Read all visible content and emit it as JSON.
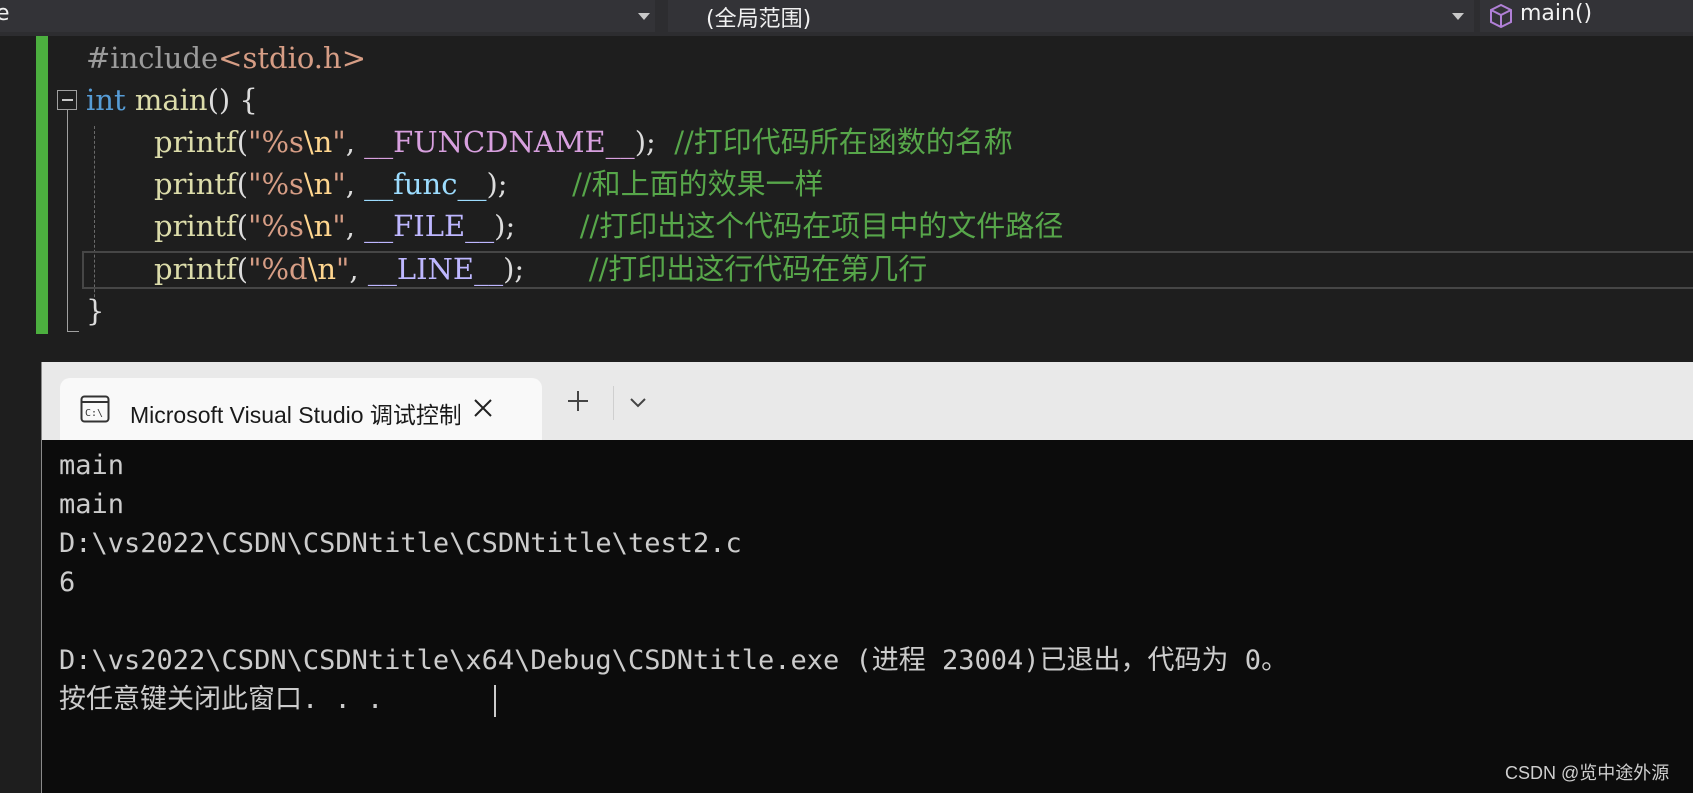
{
  "navbar": {
    "left_fragment": "e",
    "scope": "(全局范围)",
    "function_name": "main()"
  },
  "editor": {
    "lines": [
      [
        {
          "t": "#include",
          "c": "tok-pre"
        },
        {
          "t": "<stdio.h>",
          "c": "tok-inc"
        }
      ],
      [
        {
          "t": "int",
          "c": "tok-kw"
        },
        {
          "t": " ",
          "c": ""
        },
        {
          "t": "main",
          "c": "tok-fn"
        },
        {
          "t": "() {",
          "c": ""
        }
      ],
      [
        {
          "t": "printf",
          "c": "tok-fn"
        },
        {
          "t": "(",
          "c": ""
        },
        {
          "t": "\"%s",
          "c": "tok-str"
        },
        {
          "t": "\\n",
          "c": "tok-esc"
        },
        {
          "t": "\"",
          "c": "tok-str"
        },
        {
          "t": ", ",
          "c": ""
        },
        {
          "t": "__FUNCDNAME__",
          "c": "tok-macb"
        },
        {
          "t": ");  ",
          "c": ""
        },
        {
          "t": "//打印代码所在函数的名称",
          "c": "tok-cm"
        }
      ],
      [
        {
          "t": "printf",
          "c": "tok-fn"
        },
        {
          "t": "(",
          "c": ""
        },
        {
          "t": "\"%s",
          "c": "tok-str"
        },
        {
          "t": "\\n",
          "c": "tok-esc"
        },
        {
          "t": "\"",
          "c": "tok-str"
        },
        {
          "t": ", ",
          "c": ""
        },
        {
          "t": "__func__",
          "c": "tok-id"
        },
        {
          "t": ");       ",
          "c": ""
        },
        {
          "t": "//和上面的效果一样",
          "c": "tok-cm"
        }
      ],
      [
        {
          "t": "printf",
          "c": "tok-fn"
        },
        {
          "t": "(",
          "c": ""
        },
        {
          "t": "\"%s",
          "c": "tok-str"
        },
        {
          "t": "\\n",
          "c": "tok-esc"
        },
        {
          "t": "\"",
          "c": "tok-str"
        },
        {
          "t": ", ",
          "c": ""
        },
        {
          "t": "__FILE__",
          "c": "tok-mac"
        },
        {
          "t": ");       ",
          "c": ""
        },
        {
          "t": "//打印出这个代码在项目中的文件路径",
          "c": "tok-cm"
        }
      ],
      [
        {
          "t": "printf",
          "c": "tok-fn"
        },
        {
          "t": "(",
          "c": ""
        },
        {
          "t": "\"%d",
          "c": "tok-str"
        },
        {
          "t": "\\n",
          "c": "tok-esc"
        },
        {
          "t": "\"",
          "c": "tok-str"
        },
        {
          "t": ", ",
          "c": ""
        },
        {
          "t": "__LINE__",
          "c": "tok-mac"
        },
        {
          "t": ");       ",
          "c": ""
        },
        {
          "t": "//打印出这行代码在第几行",
          "c": "tok-cm"
        }
      ],
      [
        {
          "t": "}",
          "c": ""
        }
      ]
    ]
  },
  "console": {
    "tab_title": "Microsoft Visual Studio 调试控制台",
    "icon_label": "C:\\",
    "output": [
      "main",
      "main",
      "D:\\vs2022\\CSDN\\CSDNtitle\\CSDNtitle\\test2.c",
      "6",
      "",
      "D:\\vs2022\\CSDN\\CSDNtitle\\x64\\Debug\\CSDNtitle.exe (进程 23004)已退出，代码为 0。",
      "按任意键关闭此窗口. . ."
    ]
  },
  "watermark": "CSDN @览中途外源"
}
